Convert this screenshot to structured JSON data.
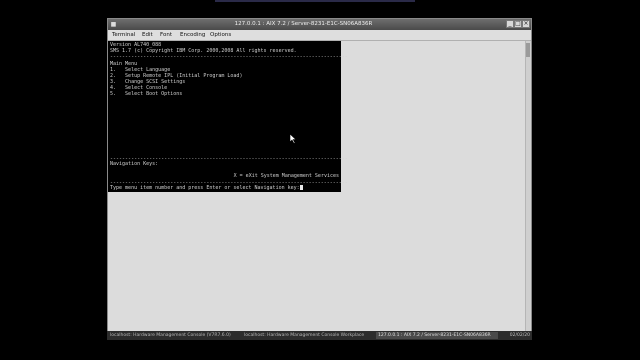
{
  "window": {
    "title": "127.0.0.1 : AIX 7.2 / Server-8231-E1C-SN06A836R",
    "controls": [
      "_",
      "□",
      "×"
    ]
  },
  "menu": [
    "Terminal",
    "Edit",
    "Font",
    "Encoding",
    "Options"
  ],
  "terminal": {
    "lines": [
      "Version AL740_088",
      "SMS 1.7 (c) Copyright IBM Corp. 2000,2008 All rights reserved.",
      "-------------------------------------------------------------------------------",
      "Main Menu",
      "1.   Select Language",
      "2.   Setup Remote IPL (Initial Program Load)",
      "3.   Change SCSI Settings",
      "4.   Select Console",
      "5.   Select Boot Options"
    ],
    "separator": "-------------------------------------------------------------------------------",
    "nav_label": "Navigation Keys:",
    "nav_exit": "X = eXit System Management Services",
    "prompt": "Type menu item number and press Enter or select Navigation key:"
  },
  "taskbar": {
    "tasks": [
      "localhost: Hardware Management Console (V7R7.6.0)",
      "localhost: Hardware Management Console Workplace",
      "127.0.0.1 : AIX 7.2 / Server-8231-E1C-SN06A836R"
    ],
    "active_index": 2,
    "clock": "02/02/20"
  }
}
